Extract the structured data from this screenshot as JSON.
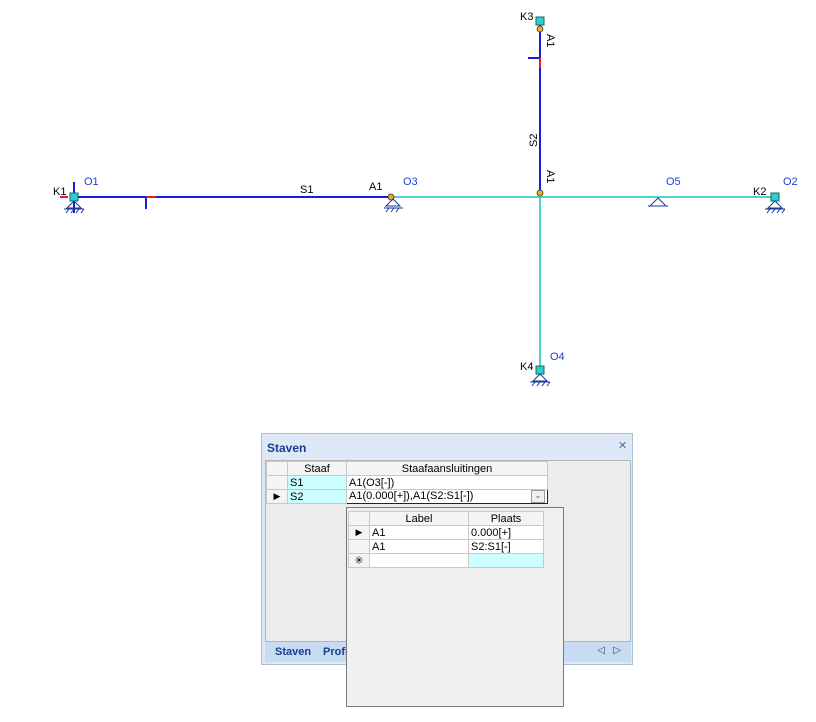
{
  "diagram": {
    "member_labels": {
      "s1": "S1",
      "s2": "S2"
    },
    "node_labels": {
      "k1": "K1",
      "k2": "K2",
      "k3": "K3",
      "k4": "K4"
    },
    "support_labels": {
      "o1": "O1",
      "o2": "O2",
      "o3": "O3",
      "o4": "O4",
      "o5": "O5"
    },
    "hinge_labels": {
      "a1_s1": "A1",
      "a1_s2_top": "A1",
      "a1_s2_bottom": "A1"
    },
    "colors": {
      "member": "#1a1ad9",
      "line_teal": "#4fd4c4",
      "node": "#33cccc",
      "hinge": "#f5a623",
      "marker": "#e02020",
      "support_label": "#1f3fd6"
    }
  },
  "panel": {
    "title": "Staven",
    "close_symbol": "×",
    "columns": {
      "staaf": "Staaf",
      "aansluitingen": "Staafaansluitingen"
    },
    "rows": [
      {
        "staaf": "S1",
        "aansluitingen": "A1(O3[-])"
      },
      {
        "staaf": "S2",
        "aansluitingen": "A1(0.000[+]),A1(S2:S1[-])"
      }
    ],
    "current_row_marker": "▶",
    "tabs": {
      "staven": "Staven",
      "profi": "Profi"
    },
    "scroll_left": "◁",
    "scroll_right": "▷"
  },
  "popup": {
    "columns": {
      "label": "Label",
      "plaats": "Plaats"
    },
    "rows": [
      {
        "label": "A1",
        "plaats": "0.000[+]"
      },
      {
        "label": "A1",
        "plaats": "S2:S1[-]"
      }
    ],
    "new_row_marker": "✳",
    "dropdown_symbol": "⌄"
  }
}
